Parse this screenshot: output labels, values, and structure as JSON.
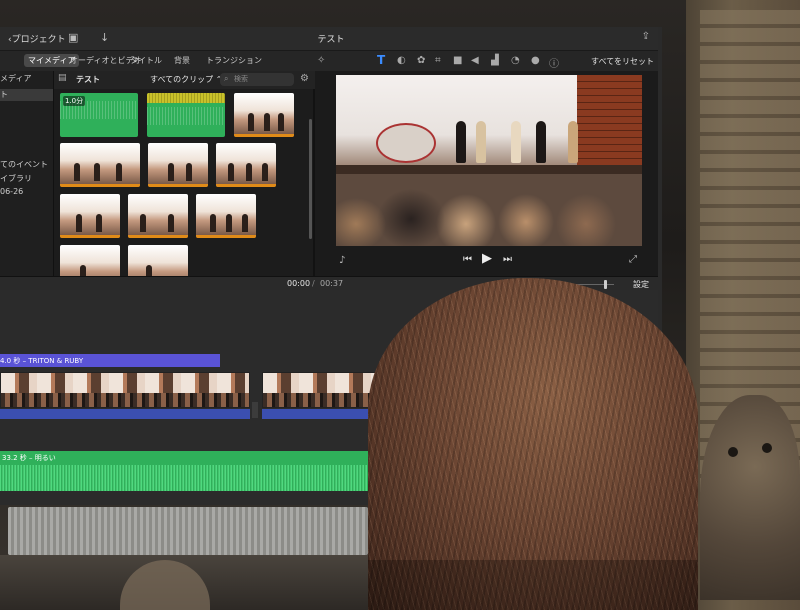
{
  "app": {
    "back_label": "プロジェクト",
    "project_title": "テスト"
  },
  "tabs": {
    "my_media": "マイメディア",
    "audio_video": "オーディオとビデオ",
    "titles": "タイトル",
    "backgrounds": "背景",
    "transitions": "トランジション"
  },
  "sidebar": {
    "items": [
      "メディア",
      "ト",
      "てのイベント",
      "イブラリ",
      "06-26"
    ]
  },
  "browser": {
    "title": "テスト",
    "filter": "すべてのクリップ",
    "search_placeholder": "検索",
    "duration_badge": "1.0分"
  },
  "viewer_toolbar": {
    "reset_all": "すべてをリセット",
    "icons": [
      "magic-wand",
      "title-T",
      "color-balance",
      "color-correction",
      "crop",
      "stabilization",
      "volume",
      "noise-reduction",
      "speed",
      "filter",
      "info"
    ]
  },
  "timecode": {
    "current": "00:00",
    "separator": "/",
    "total": "00:37"
  },
  "timeline": {
    "settings_label": "設定",
    "title_clip_label": "4.0 秒 – TRITON & RUBY",
    "audio_clip_label": "33.2 秒 – 明るい"
  },
  "colors": {
    "accent": "#3b8cff",
    "title_track": "#5a53d6",
    "audio_track": "#2fb05a",
    "clip_bar": "#e08b18"
  }
}
